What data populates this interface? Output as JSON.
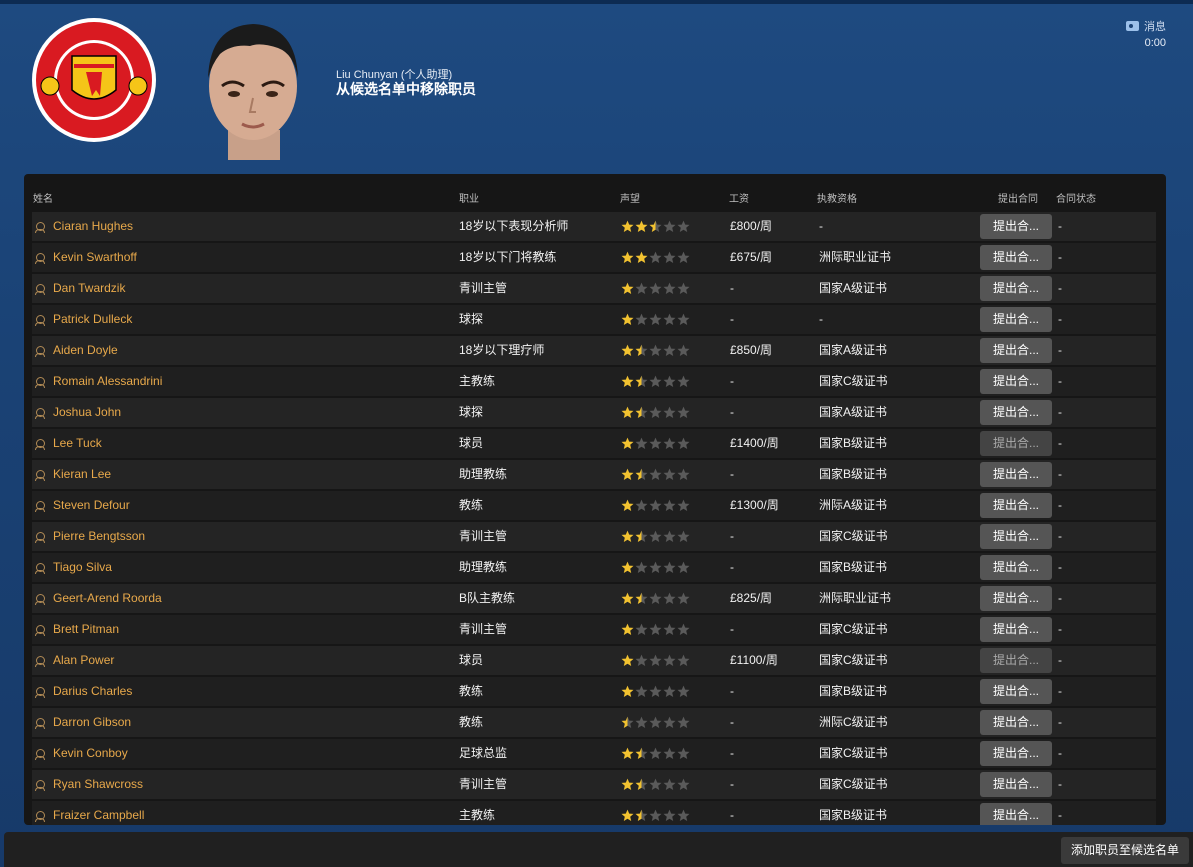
{
  "header": {
    "speaker": "Liu Chunyan (个人助理)",
    "headline": "从候选名单中移除职员",
    "inbox_label": "消息",
    "inbox_time": "0:00"
  },
  "table": {
    "columns": {
      "name": "姓名",
      "role": "职业",
      "reputation": "声望",
      "wage": "工资",
      "license": "执教资格",
      "offer": "提出合同",
      "contract_status": "合同状态"
    },
    "rows": [
      {
        "name": "Ciaran Hughes",
        "role": "18岁以下表现分析师",
        "stars": 2.5,
        "wage": "£800/周",
        "license": "-",
        "button": "提出合...",
        "status": "-",
        "disabled": false
      },
      {
        "name": "Kevin Swarthoff",
        "role": "18岁以下门将教练",
        "stars": 2,
        "wage": "£675/周",
        "license": "洲际职业证书",
        "button": "提出合...",
        "status": "-",
        "disabled": false
      },
      {
        "name": "Dan Twardzik",
        "role": "青训主管",
        "stars": 1,
        "wage": "-",
        "license": "国家A级证书",
        "button": "提出合...",
        "status": "-",
        "disabled": false
      },
      {
        "name": "Patrick Dulleck",
        "role": "球探",
        "stars": 1,
        "wage": "-",
        "license": "-",
        "button": "提出合...",
        "status": "-",
        "disabled": false
      },
      {
        "name": "Aiden Doyle",
        "role": "18岁以下理疗师",
        "stars": 1.5,
        "wage": "£850/周",
        "license": "国家A级证书",
        "button": "提出合...",
        "status": "-",
        "disabled": false
      },
      {
        "name": "Romain Alessandrini",
        "role": "主教练",
        "stars": 1.5,
        "wage": "-",
        "license": "国家C级证书",
        "button": "提出合...",
        "status": "-",
        "disabled": false
      },
      {
        "name": "Joshua John",
        "role": "球探",
        "stars": 1.5,
        "wage": "-",
        "license": "国家A级证书",
        "button": "提出合...",
        "status": "-",
        "disabled": false
      },
      {
        "name": "Lee Tuck",
        "role": "球员",
        "stars": 1,
        "wage": "£1400/周",
        "license": "国家B级证书",
        "button": "提出合...",
        "status": "-",
        "disabled": true
      },
      {
        "name": "Kieran Lee",
        "role": "助理教练",
        "stars": 1.5,
        "wage": "-",
        "license": "国家B级证书",
        "button": "提出合...",
        "status": "-",
        "disabled": false
      },
      {
        "name": "Steven Defour",
        "role": "教练",
        "stars": 1,
        "wage": "£1300/周",
        "license": "洲际A级证书",
        "button": "提出合...",
        "status": "-",
        "disabled": false
      },
      {
        "name": "Pierre Bengtsson",
        "role": "青训主管",
        "stars": 1.5,
        "wage": "-",
        "license": "国家C级证书",
        "button": "提出合...",
        "status": "-",
        "disabled": false
      },
      {
        "name": "Tiago Silva",
        "role": "助理教练",
        "stars": 1,
        "wage": "-",
        "license": "国家B级证书",
        "button": "提出合...",
        "status": "-",
        "disabled": false
      },
      {
        "name": "Geert-Arend Roorda",
        "role": "B队主教练",
        "stars": 1.5,
        "wage": "£825/周",
        "license": "洲际职业证书",
        "button": "提出合...",
        "status": "-",
        "disabled": false
      },
      {
        "name": "Brett Pitman",
        "role": "青训主管",
        "stars": 1,
        "wage": "-",
        "license": "国家C级证书",
        "button": "提出合...",
        "status": "-",
        "disabled": false
      },
      {
        "name": "Alan Power",
        "role": "球员",
        "stars": 1,
        "wage": "£1100/周",
        "license": "国家C级证书",
        "button": "提出合...",
        "status": "-",
        "disabled": true
      },
      {
        "name": "Darius Charles",
        "role": "教练",
        "stars": 1,
        "wage": "-",
        "license": "国家B级证书",
        "button": "提出合...",
        "status": "-",
        "disabled": false
      },
      {
        "name": "Darron Gibson",
        "role": "教练",
        "stars": 0.5,
        "wage": "-",
        "license": "洲际C级证书",
        "button": "提出合...",
        "status": "-",
        "disabled": false
      },
      {
        "name": "Kevin Conboy",
        "role": "足球总监",
        "stars": 1.5,
        "wage": "-",
        "license": "国家C级证书",
        "button": "提出合...",
        "status": "-",
        "disabled": false
      },
      {
        "name": "Ryan Shawcross",
        "role": "青训主管",
        "stars": 1.5,
        "wage": "-",
        "license": "国家C级证书",
        "button": "提出合...",
        "status": "-",
        "disabled": false
      },
      {
        "name": "Fraizer Campbell",
        "role": "主教练",
        "stars": 1.5,
        "wage": "-",
        "license": "国家B级证书",
        "button": "提出合...",
        "status": "-",
        "disabled": false
      }
    ]
  },
  "footer": {
    "add_button": "添加职员至候选名单"
  },
  "colors": {
    "star_on": "#f2c230",
    "star_off": "#5a5a5a",
    "name_text": "#e8a94b"
  },
  "icons": {
    "inbox": "message-icon",
    "row_person": "person-icon",
    "rating": "star-icon"
  }
}
